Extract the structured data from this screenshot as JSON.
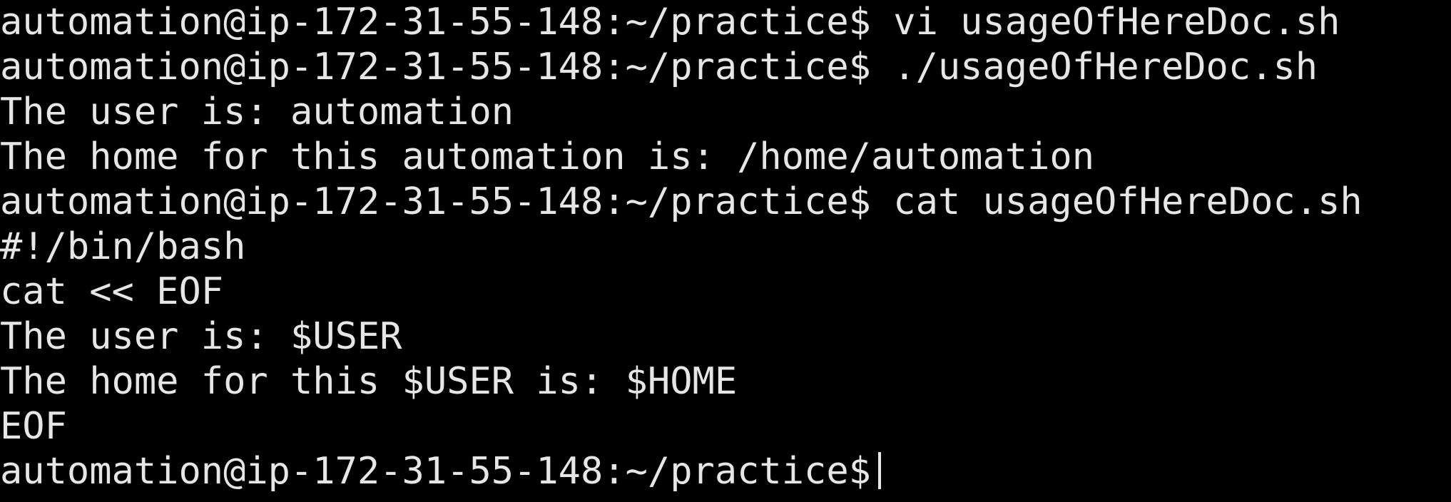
{
  "terminal": {
    "lines": [
      "automation@ip-172-31-55-148:~/practice$ vi usageOfHereDoc.sh",
      "automation@ip-172-31-55-148:~/practice$ ./usageOfHereDoc.sh",
      "The user is: automation",
      "The home for this automation is: /home/automation",
      "automation@ip-172-31-55-148:~/practice$ cat usageOfHereDoc.sh",
      "#!/bin/bash",
      "cat << EOF",
      "The user is: $USER",
      "The home for this $USER is: $HOME",
      "EOF",
      "automation@ip-172-31-55-148:~/practice$"
    ],
    "colors": {
      "background": "#000000",
      "foreground": "#e6e6e6"
    }
  }
}
